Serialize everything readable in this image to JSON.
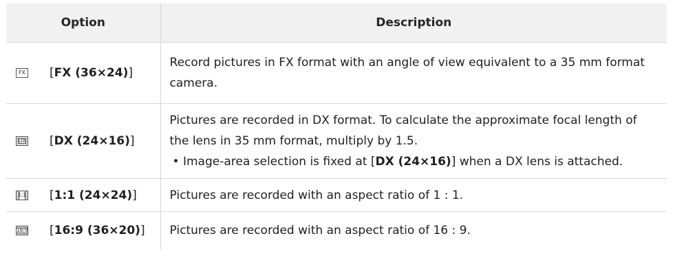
{
  "header": {
    "option": "Option",
    "description": "Description"
  },
  "rows": [
    {
      "icon": "fx-format-icon",
      "icon_text": "FX",
      "name_bold": "FX (36×24)",
      "description": "Record pictures in FX format with an angle of view equivalent to a 35 mm format camera."
    },
    {
      "icon": "dx-format-icon",
      "icon_text": "DX",
      "name_bold": "DX (24×16)",
      "description": "Pictures are recorded in DX format. To calculate the approximate focal length of the lens in 35 mm format, multiply by 1.5.",
      "note": {
        "bullet": "•",
        "before": " Image-area selection is fixed at [",
        "bold": "DX (24×16)",
        "after": "] when a DX lens is attached."
      }
    },
    {
      "icon": "1-1-format-icon",
      "icon_text": "1:1",
      "name_bold": "1:1 (24×24)",
      "description": "Pictures are recorded with an aspect ratio of 1 : 1."
    },
    {
      "icon": "16-9-format-icon",
      "icon_text": "16:9",
      "name_bold": "16:9 (36×20)",
      "description": "Pictures are recorded with an aspect ratio of 16 : 9."
    }
  ]
}
